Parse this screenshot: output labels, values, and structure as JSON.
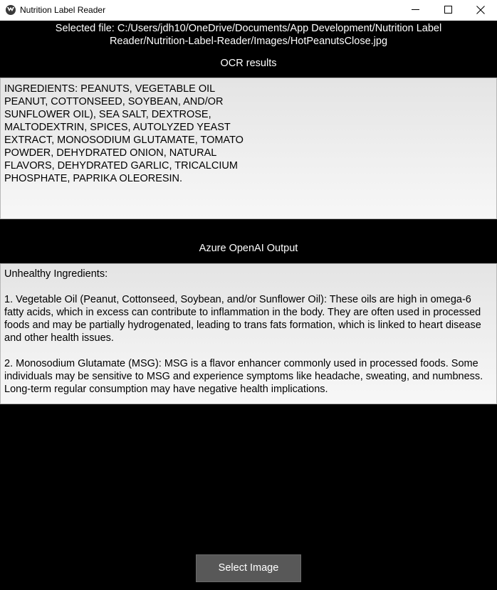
{
  "window": {
    "title": "Nutrition Label Reader"
  },
  "selected_file": {
    "line1": "Selected file: C:/Users/jdh10/OneDrive/Documents/App Development/Nutrition Label",
    "line2": "Reader/Nutrition-Label-Reader/Images/HotPeanutsClose.jpg"
  },
  "ocr": {
    "heading": "OCR results",
    "lines": [
      "INGREDIENTS: PEANUTS, VEGETABLE OIL",
      "PEANUT, COTTONSEED, SOYBEAN, AND/OR",
      "SUNFLOWER OIL), SEA SALT, DEXTROSE,",
      "MALTODEXTRIN, SPICES, AUTOLYZED YEAST",
      "EXTRACT, MONOSODIUM GLUTAMATE, TOMATO",
      "POWDER, DEHYDRATED ONION, NATURAL",
      "FLAVORS, DEHYDRATED GARLIC, TRICALCIUM",
      "PHOSPHATE, PAPRIKA OLEORESIN."
    ]
  },
  "azure": {
    "heading": "Azure OpenAI Output",
    "intro": "Unhealthy Ingredients:",
    "item1": "1. Vegetable Oil (Peanut, Cottonseed, Soybean, and/or Sunflower Oil): These oils are high in omega-6 fatty acids, which in excess can contribute to inflammation in the body. They are often used in processed foods and may be partially hydrogenated, leading to trans fats formation, which is linked to heart disease and other health issues.",
    "item2": "2. Monosodium Glutamate (MSG): MSG is a flavor enhancer commonly used in processed foods. Some individuals may be sensitive to MSG and experience symptoms like headache, sweating, and numbness. Long-term regular consumption may have negative health implications."
  },
  "actions": {
    "select_image_label": "Select Image"
  },
  "colors": {
    "background": "#000000",
    "titlebar": "#ffffff",
    "button": "#585858",
    "textbox": "#f0f0f0"
  }
}
